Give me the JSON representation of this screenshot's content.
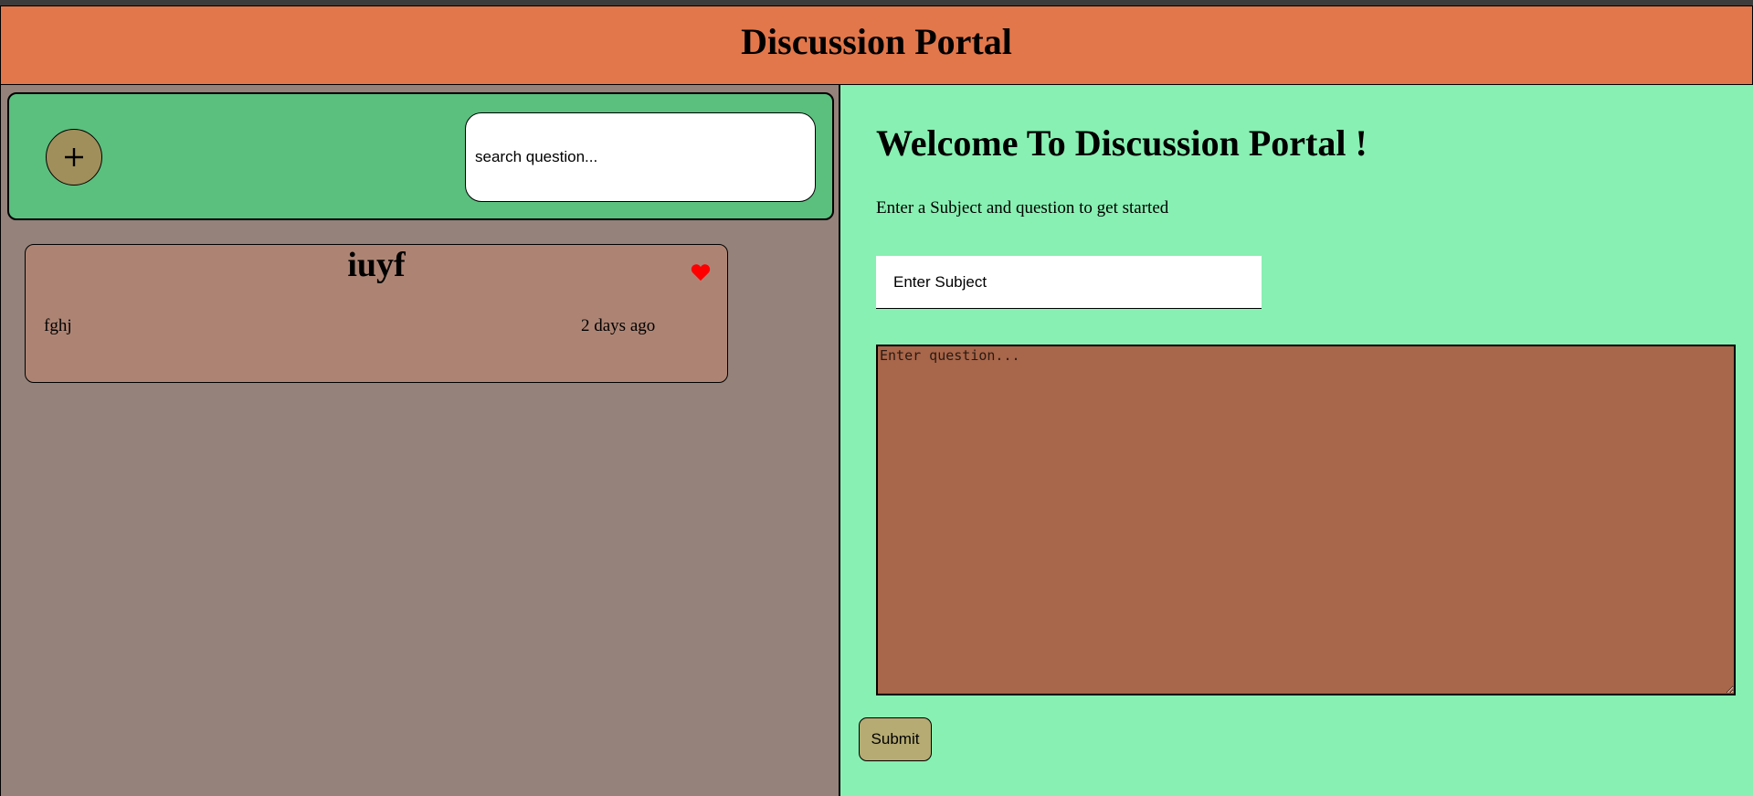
{
  "header": {
    "title": "Discussion Portal"
  },
  "toolbar": {
    "add_icon": "plus-icon",
    "search": {
      "placeholder": "search question..."
    }
  },
  "questions": [
    {
      "subject": "iuyf",
      "body": "fghj",
      "time": "2 days ago",
      "favorite_icon": "heart-icon",
      "favorite_color": "#ff0000"
    }
  ],
  "form": {
    "welcome": "Welcome To Discussion Portal !",
    "subtitle": "Enter a Subject and question to get started",
    "subject_placeholder": "Enter Subject",
    "question_placeholder": "Enter question...",
    "submit_label": "Submit"
  },
  "colors": {
    "header": "#e2774b",
    "left_panel": "#94827b",
    "toolbar": "#5bbf7e",
    "card": "#ad8474",
    "right_panel": "#88f0b2",
    "textarea": "#a8664a",
    "submit": "#b5ab73",
    "add_button": "#a18f5b"
  }
}
